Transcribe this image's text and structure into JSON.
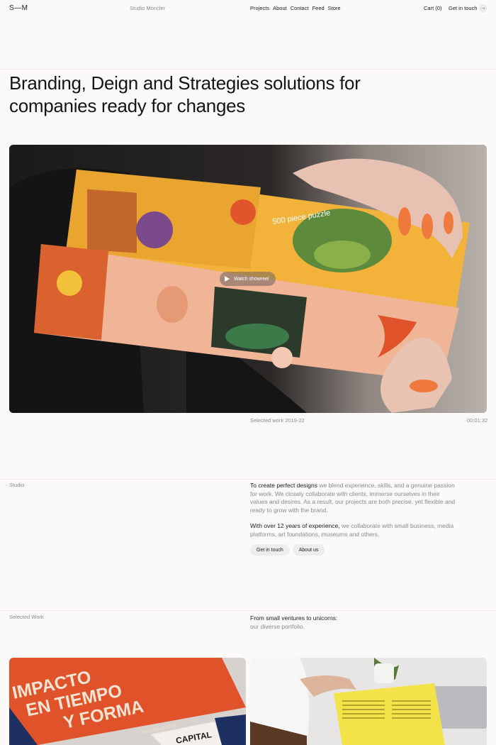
{
  "header": {
    "logo": "S—M",
    "studio_name": "Studio Moncler",
    "nav": [
      "Projects",
      "About",
      "Contact",
      "Feed",
      "Store"
    ],
    "cart": "Cart (0)",
    "get_in_touch": "Get in touch",
    "arrow_icon": "→"
  },
  "hero": {
    "title": "Branding, Deign and Strategies solutions for companies ready for changes"
  },
  "showreel": {
    "button_label": "Watch showreel",
    "box_text": "500 piece puzzle",
    "caption": "Selected work 2019-22",
    "timecode": "00:01:32"
  },
  "studio": {
    "label": "Studio",
    "p1_em": "To create perfect designs",
    "p1_rest": " we blend experience, skills, and a genuine passion for work. We closely collaborate with clients, immerse ourselves in their values and desires. As a result, our projects are both precise, yet flexible and ready to grow with the brand.",
    "p2_em": "With over 12 years of experience,",
    "p2_rest": " we collaborate with small business, media platforms, art foundations, museums and others.",
    "btn_contact": "Get in touch",
    "btn_about": "About us"
  },
  "selected_work": {
    "label": "Selected Work",
    "title_line1": "From small ventures to unicorns:",
    "title_line2": "our diverse portfolio.",
    "card1_poster": [
      "IMPACTO",
      "EN TIEMPO",
      "Y FORMA"
    ],
    "card1_small": "CASTRO CAPITAL",
    "card1_sheet": "CAPITAL"
  },
  "colors": {
    "background": "#fcfaf9",
    "muted": "#8a8a8a",
    "pill": "#efedeb",
    "poster_orange": "#e0522a"
  }
}
